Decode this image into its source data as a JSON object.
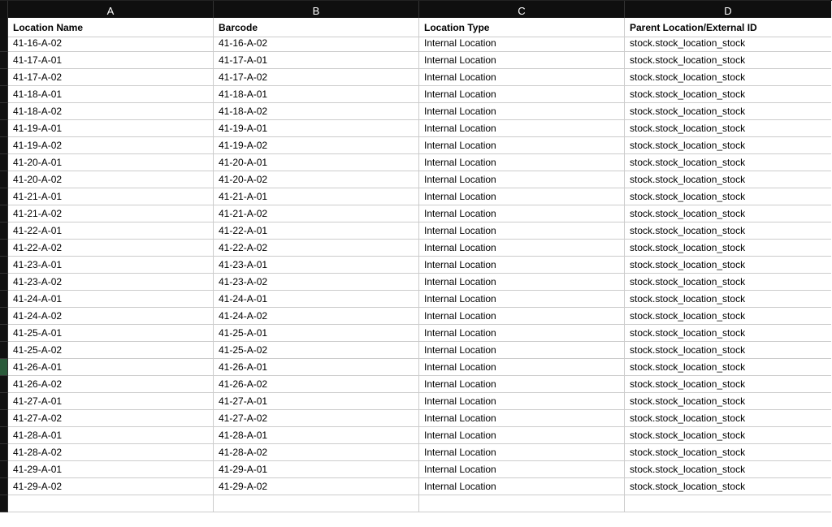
{
  "columns": [
    "A",
    "B",
    "C",
    "D"
  ],
  "headers": {
    "A": "Location Name",
    "B": "Barcode",
    "C": "Location Type",
    "D": "Parent Location/External ID"
  },
  "selected_row_index": 19,
  "rows": [
    {
      "A": "41-16-A-02",
      "B": "41-16-A-02",
      "C": "Internal Location",
      "D": "stock.stock_location_stock"
    },
    {
      "A": "41-17-A-01",
      "B": "41-17-A-01",
      "C": "Internal Location",
      "D": "stock.stock_location_stock"
    },
    {
      "A": "41-17-A-02",
      "B": "41-17-A-02",
      "C": "Internal Location",
      "D": "stock.stock_location_stock"
    },
    {
      "A": "41-18-A-01",
      "B": "41-18-A-01",
      "C": "Internal Location",
      "D": "stock.stock_location_stock"
    },
    {
      "A": "41-18-A-02",
      "B": "41-18-A-02",
      "C": "Internal Location",
      "D": "stock.stock_location_stock"
    },
    {
      "A": "41-19-A-01",
      "B": "41-19-A-01",
      "C": "Internal Location",
      "D": "stock.stock_location_stock"
    },
    {
      "A": "41-19-A-02",
      "B": "41-19-A-02",
      "C": "Internal Location",
      "D": "stock.stock_location_stock"
    },
    {
      "A": "41-20-A-01",
      "B": "41-20-A-01",
      "C": "Internal Location",
      "D": "stock.stock_location_stock"
    },
    {
      "A": "41-20-A-02",
      "B": "41-20-A-02",
      "C": "Internal Location",
      "D": "stock.stock_location_stock"
    },
    {
      "A": "41-21-A-01",
      "B": "41-21-A-01",
      "C": "Internal Location",
      "D": "stock.stock_location_stock"
    },
    {
      "A": "41-21-A-02",
      "B": "41-21-A-02",
      "C": "Internal Location",
      "D": "stock.stock_location_stock"
    },
    {
      "A": "41-22-A-01",
      "B": "41-22-A-01",
      "C": "Internal Location",
      "D": "stock.stock_location_stock"
    },
    {
      "A": "41-22-A-02",
      "B": "41-22-A-02",
      "C": "Internal Location",
      "D": "stock.stock_location_stock"
    },
    {
      "A": "41-23-A-01",
      "B": "41-23-A-01",
      "C": "Internal Location",
      "D": "stock.stock_location_stock"
    },
    {
      "A": "41-23-A-02",
      "B": "41-23-A-02",
      "C": "Internal Location",
      "D": "stock.stock_location_stock"
    },
    {
      "A": "41-24-A-01",
      "B": "41-24-A-01",
      "C": "Internal Location",
      "D": "stock.stock_location_stock"
    },
    {
      "A": "41-24-A-02",
      "B": "41-24-A-02",
      "C": "Internal Location",
      "D": "stock.stock_location_stock"
    },
    {
      "A": "41-25-A-01",
      "B": "41-25-A-01",
      "C": "Internal Location",
      "D": "stock.stock_location_stock"
    },
    {
      "A": "41-25-A-02",
      "B": "41-25-A-02",
      "C": "Internal Location",
      "D": "stock.stock_location_stock"
    },
    {
      "A": "41-26-A-01",
      "B": "41-26-A-01",
      "C": "Internal Location",
      "D": "stock.stock_location_stock"
    },
    {
      "A": "41-26-A-02",
      "B": "41-26-A-02",
      "C": "Internal Location",
      "D": "stock.stock_location_stock"
    },
    {
      "A": "41-27-A-01",
      "B": "41-27-A-01",
      "C": "Internal Location",
      "D": "stock.stock_location_stock"
    },
    {
      "A": "41-27-A-02",
      "B": "41-27-A-02",
      "C": "Internal Location",
      "D": "stock.stock_location_stock"
    },
    {
      "A": "41-28-A-01",
      "B": "41-28-A-01",
      "C": "Internal Location",
      "D": "stock.stock_location_stock"
    },
    {
      "A": "41-28-A-02",
      "B": "41-28-A-02",
      "C": "Internal Location",
      "D": "stock.stock_location_stock"
    },
    {
      "A": "41-29-A-01",
      "B": "41-29-A-01",
      "C": "Internal Location",
      "D": "stock.stock_location_stock"
    },
    {
      "A": "41-29-A-02",
      "B": "41-29-A-02",
      "C": "Internal Location",
      "D": "stock.stock_location_stock"
    }
  ],
  "trailing_empty_rows": 1
}
